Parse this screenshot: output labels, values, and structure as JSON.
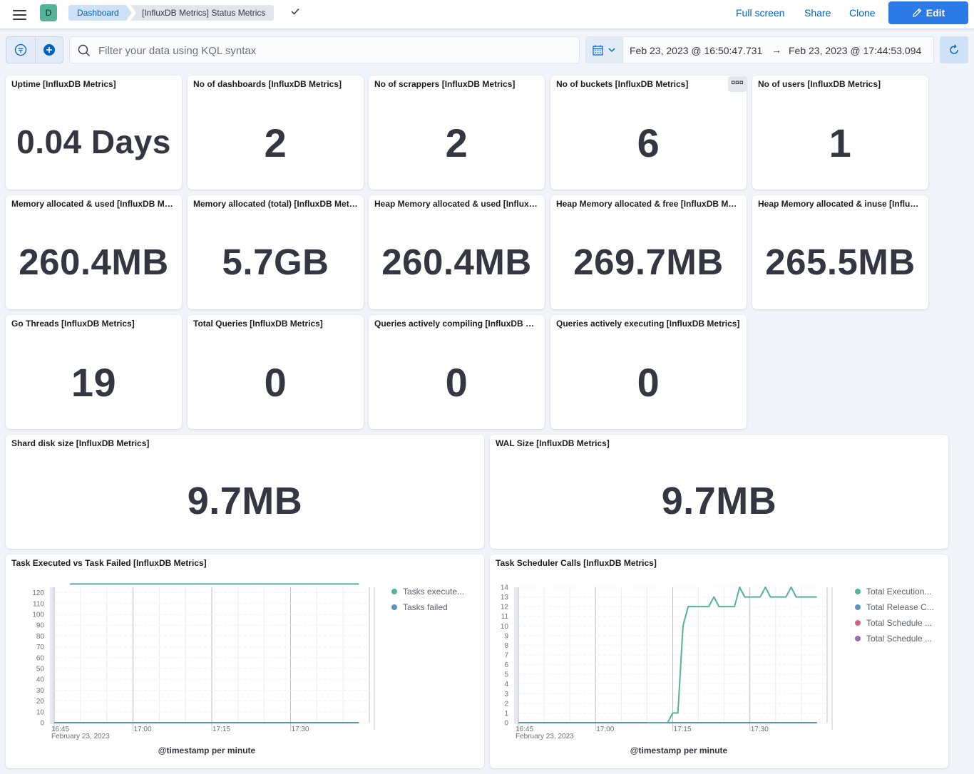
{
  "header": {
    "avatar_letter": "D",
    "breadcrumb_root": "Dashboard",
    "breadcrumb_current": "[InfluxDB Metrics] Status Metrics",
    "full_screen": "Full screen",
    "share": "Share",
    "clone": "Clone",
    "edit": "Edit"
  },
  "query": {
    "placeholder": "Filter your data using KQL syntax",
    "date_start": "Feb 23, 2023 @ 16:50:47.731",
    "date_arrow": "→",
    "date_end": "Feb 23, 2023 @ 17:44:53.094"
  },
  "panels": [
    {
      "title": "Uptime [InfluxDB Metrics]",
      "value": "0.04 Days"
    },
    {
      "title": "No of dashboards [InfluxDB Metrics]",
      "value": "2"
    },
    {
      "title": "No of scrappers [InfluxDB Metrics]",
      "value": "2"
    },
    {
      "title": "No of buckets [InfluxDB Metrics]",
      "value": "6"
    },
    {
      "title": "No of users [InfluxDB Metrics]",
      "value": "1"
    },
    {
      "title": "Memory allocated & used [InfluxDB Metrics]",
      "value": "260.4MB"
    },
    {
      "title": "Memory allocated (total) [InfluxDB Metrics]",
      "value": "5.7GB"
    },
    {
      "title": "Heap Memory allocated & used [InfluxDB Metrics]",
      "value": "260.4MB"
    },
    {
      "title": "Heap Memory allocated & free [InfluxDB Metrics]",
      "value": "269.7MB"
    },
    {
      "title": "Heap Memory allocated & inuse [InfluxDB Metrics]",
      "value": "265.5MB"
    },
    {
      "title": "Go Threads [InfluxDB Metrics]",
      "value": "19"
    },
    {
      "title": "Total Queries [InfluxDB Metrics]",
      "value": "0"
    },
    {
      "title": "Queries actively compiling [InfluxDB Metrics]",
      "value": "0"
    },
    {
      "title": "Queries actively executing [InfluxDB Metrics]",
      "value": "0"
    },
    {
      "title": "Shard disk size [InfluxDB Metrics]",
      "value": "9.7MB"
    },
    {
      "title": "WAL Size [InfluxDB Metrics]",
      "value": "9.7MB"
    }
  ],
  "panel_menu_icon": "ellipsis-icon",
  "colors": {
    "green": "#54b399",
    "blue": "#6092c0",
    "pink": "#d36086",
    "purple": "#9170b8",
    "accent": "#2c79e8"
  },
  "chart_data": [
    {
      "type": "line",
      "title": "Task Executed vs Task Failed [InfluxDB Metrics]",
      "xlabel": "@timestamp per minute",
      "x_ticks": [
        "16:45",
        "17:00",
        "17:15",
        "17:30"
      ],
      "x_date_label": "February 23, 2023",
      "x_range": [
        "16:45",
        "17:45"
      ],
      "ylim": [
        0,
        125
      ],
      "y_ticks": [
        0,
        10,
        20,
        30,
        40,
        50,
        60,
        70,
        80,
        90,
        100,
        110,
        120
      ],
      "legend_position": "top-right",
      "series": [
        {
          "name": "Tasks execute...",
          "color": "#54b399",
          "points": [
            [
              "16:48",
              128
            ],
            [
              "17:43",
              128
            ]
          ]
        },
        {
          "name": "Tasks failed",
          "color": "#6092c0",
          "points": [
            [
              "16:45",
              0
            ],
            [
              "17:43",
              0
            ]
          ]
        }
      ]
    },
    {
      "type": "line",
      "title": "Task Scheduler Calls [InfluxDB Metrics]",
      "xlabel": "@timestamp per minute",
      "x_ticks": [
        "16:45",
        "17:00",
        "17:15",
        "17:30"
      ],
      "x_date_label": "February 23, 2023",
      "x_range": [
        "16:45",
        "17:45"
      ],
      "ylim": [
        0,
        14
      ],
      "y_ticks": [
        0,
        1,
        2,
        3,
        4,
        5,
        6,
        7,
        8,
        9,
        10,
        11,
        12,
        13,
        14
      ],
      "legend_position": "top-right",
      "series": [
        {
          "name": "Total Execution...",
          "color": "#54b399",
          "points": [
            [
              "17:10",
              0
            ],
            [
              "17:14",
              0
            ],
            [
              "17:15",
              1
            ],
            [
              "17:16",
              1
            ],
            [
              "17:17",
              10
            ],
            [
              "17:18",
              12
            ],
            [
              "17:22",
              12
            ],
            [
              "17:23",
              13
            ],
            [
              "17:24",
              12
            ],
            [
              "17:27",
              12
            ],
            [
              "17:28",
              14
            ],
            [
              "17:29",
              13
            ],
            [
              "17:32",
              13
            ],
            [
              "17:33",
              14
            ],
            [
              "17:34",
              13
            ],
            [
              "17:37",
              13
            ],
            [
              "17:38",
              14
            ],
            [
              "17:39",
              13
            ],
            [
              "17:43",
              13
            ]
          ]
        },
        {
          "name": "Total Release C...",
          "color": "#6092c0",
          "points": [
            [
              "16:45",
              0
            ],
            [
              "17:43",
              0
            ]
          ]
        },
        {
          "name": "Total Schedule ...",
          "color": "#d36086",
          "points": [
            [
              "16:45",
              0
            ],
            [
              "17:43",
              0
            ]
          ]
        },
        {
          "name": "Total Schedule ...",
          "color": "#9170b8",
          "points": [
            [
              "16:45",
              0
            ],
            [
              "17:43",
              0
            ]
          ]
        }
      ]
    }
  ]
}
